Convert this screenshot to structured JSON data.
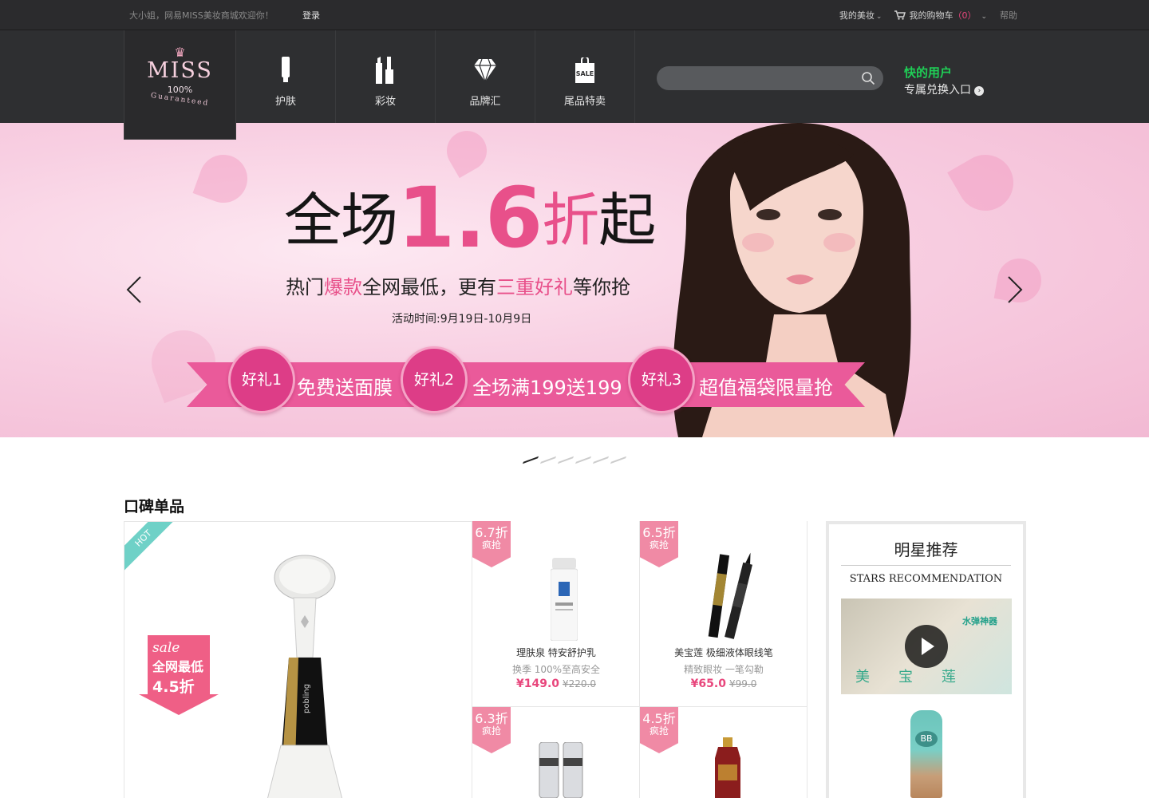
{
  "topbar": {
    "welcome": "大小姐，网易MISS美妆商城欢迎你！",
    "login": "登录",
    "my_beauty": "我的美妆",
    "cart_label": "我的购物车",
    "cart_count": "（0）",
    "help": "帮助"
  },
  "logo": {
    "name": "MISS",
    "percent": "100%",
    "guaranteed": "Guaranteed"
  },
  "nav": {
    "items": [
      {
        "label": "护肤",
        "icon": "bottle-icon"
      },
      {
        "label": "彩妆",
        "icon": "lipstick-icon"
      },
      {
        "label": "品牌汇",
        "icon": "diamond-icon"
      },
      {
        "label": "尾品特卖",
        "icon": "sale-bag-icon"
      }
    ]
  },
  "search": {
    "placeholder": ""
  },
  "promo_link": {
    "line1": "快的用户",
    "line2": "专属兑换入口"
  },
  "banner": {
    "headline_pre": "全场",
    "headline_number": "1.6",
    "headline_mid": "折",
    "headline_post": "起",
    "sub_1": "热门",
    "sub_2": "爆款",
    "sub_3": "全网最低，更有",
    "sub_4": "三重好礼",
    "sub_5": "等你抢",
    "time": "活动时间:9月19日-10月9日",
    "gifts": [
      {
        "badge": "好礼1",
        "text": "免费送面膜"
      },
      {
        "badge": "好礼2",
        "text": "全场满199送199"
      },
      {
        "badge": "好礼3",
        "text": "超值福袋限量抢"
      }
    ],
    "slide_count": 6,
    "active_slide": 1
  },
  "section": {
    "title": "口碑单品",
    "feature": {
      "hot": "HOT",
      "sale_script": "sale",
      "sale_line1": "全网最低",
      "sale_line2": "4.5折"
    },
    "products": [
      {
        "disc": "6.7折",
        "tag": "疯抢",
        "name": "理肤泉 特安舒护乳",
        "desc": "换季 100%至高安全",
        "price": "¥149.0",
        "old": "¥220.0"
      },
      {
        "disc": "6.5折",
        "tag": "疯抢",
        "name": "美宝莲 极细液体眼线笔",
        "desc": "精致眼妆 一笔勾勒",
        "price": "¥65.0",
        "old": "¥99.0"
      },
      {
        "disc": "6.3折",
        "tag": "疯抢"
      },
      {
        "disc": "4.5折",
        "tag": "疯抢"
      }
    ],
    "stars": {
      "title_cn": "明星推荐",
      "title_en": "STARS RECOMMENDATION",
      "video_text": "水弹神器",
      "video_brand": "美宝莲",
      "bb_label": "BB"
    }
  },
  "colors": {
    "accent_pink": "#e8508a",
    "topbar_bg": "#2b2b2d",
    "header_bg": "#2e2f31",
    "promo_green": "#1fce56"
  }
}
